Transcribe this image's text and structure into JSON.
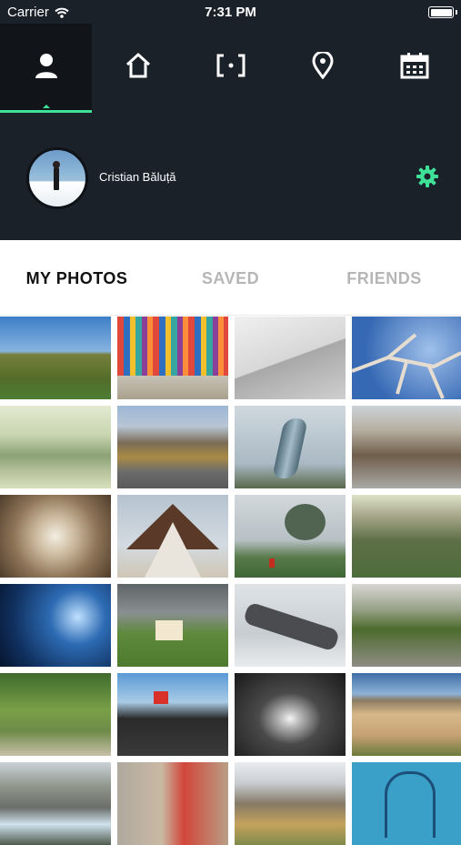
{
  "status_bar": {
    "carrier": "Carrier",
    "time": "7:31 PM"
  },
  "nav": {
    "items": [
      {
        "name": "profile",
        "icon": "user-icon",
        "active": true
      },
      {
        "name": "home",
        "icon": "home-icon",
        "active": false
      },
      {
        "name": "scan",
        "icon": "scan-icon",
        "active": false
      },
      {
        "name": "location",
        "icon": "map-pin-icon",
        "active": false
      },
      {
        "name": "calendar",
        "icon": "calendar-icon",
        "active": false
      }
    ]
  },
  "profile": {
    "name": "Cristian Băluță"
  },
  "tabs": [
    {
      "label": "MY PHOTOS",
      "active": true
    },
    {
      "label": "SAVED",
      "active": false
    },
    {
      "label": "FRIENDS",
      "active": false
    }
  ],
  "colors": {
    "accent": "#3ee197",
    "header_bg": "#1b2129",
    "active_nav_bg": "#111519"
  },
  "photos": [
    "hills-landscape",
    "colorful-building",
    "white-architecture",
    "tree-branches",
    "misty-valley",
    "mountain-town",
    "twisted-sculpture",
    "street-houses",
    "wooden-frames",
    "triangle-building",
    "foggy-tree",
    "forest-rocks",
    "library-shelves",
    "grass-roof-house",
    "plane-wreck",
    "desert-road",
    "garden-path",
    "bridge-walkway",
    "tunnel-arch",
    "sand-dunes",
    "waterfall",
    "brick-building",
    "colorful-mountains",
    "blue-gate"
  ]
}
